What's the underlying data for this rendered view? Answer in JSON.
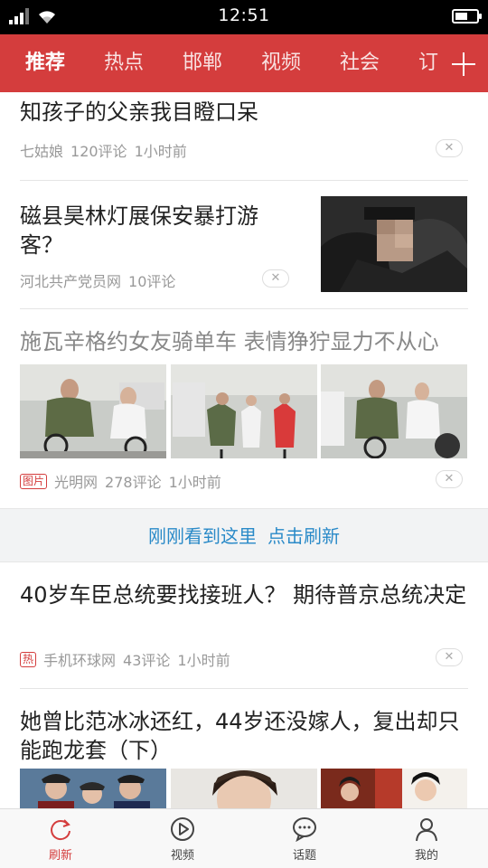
{
  "status_bar": {
    "time": "12:51"
  },
  "channels": {
    "tabs": [
      {
        "label": "推荐",
        "active": true
      },
      {
        "label": "热点"
      },
      {
        "label": "邯郸"
      },
      {
        "label": "视频"
      },
      {
        "label": "社会"
      },
      {
        "label": "订"
      }
    ],
    "add_icon": "plus-icon"
  },
  "feed": {
    "items": [
      {
        "title": "知孩子的父亲我目瞪口呆",
        "source": "七姑娘",
        "comments": "120评论",
        "time": "1小时前",
        "dismiss": "✕"
      },
      {
        "title": "磁县昊林灯展保安暴打游客？",
        "source": "河北共产党员网",
        "comments": "10评论",
        "dismiss": "✕"
      },
      {
        "title": "施瓦辛格约女友骑单车 表情狰狞显力不从心",
        "tag": "图片",
        "source": "光明网",
        "comments": "278评论",
        "time": "1小时前",
        "dismiss": "✕"
      },
      {
        "title": "40岁车臣总统要找接班人？ 期待普京总统决定",
        "tag": "热",
        "source": "手机环球网",
        "comments": "43评论",
        "time": "1小时前",
        "dismiss": "✕"
      },
      {
        "title": "她曾比范冰冰还红，44岁还没嫁人，复出却只能跑龙套（下）"
      }
    ],
    "refresh": {
      "seen_text": "刚刚看到这里",
      "action_text": "点击刷新"
    }
  },
  "bottom_nav": {
    "items": [
      {
        "label": "刷新",
        "icon": "refresh-icon",
        "active": true
      },
      {
        "label": "视频",
        "icon": "play-icon"
      },
      {
        "label": "话题",
        "icon": "chat-icon"
      },
      {
        "label": "我的",
        "icon": "user-icon"
      }
    ]
  },
  "colors": {
    "brand_red": "#d43d3d",
    "link_blue": "#2a8ac8"
  }
}
